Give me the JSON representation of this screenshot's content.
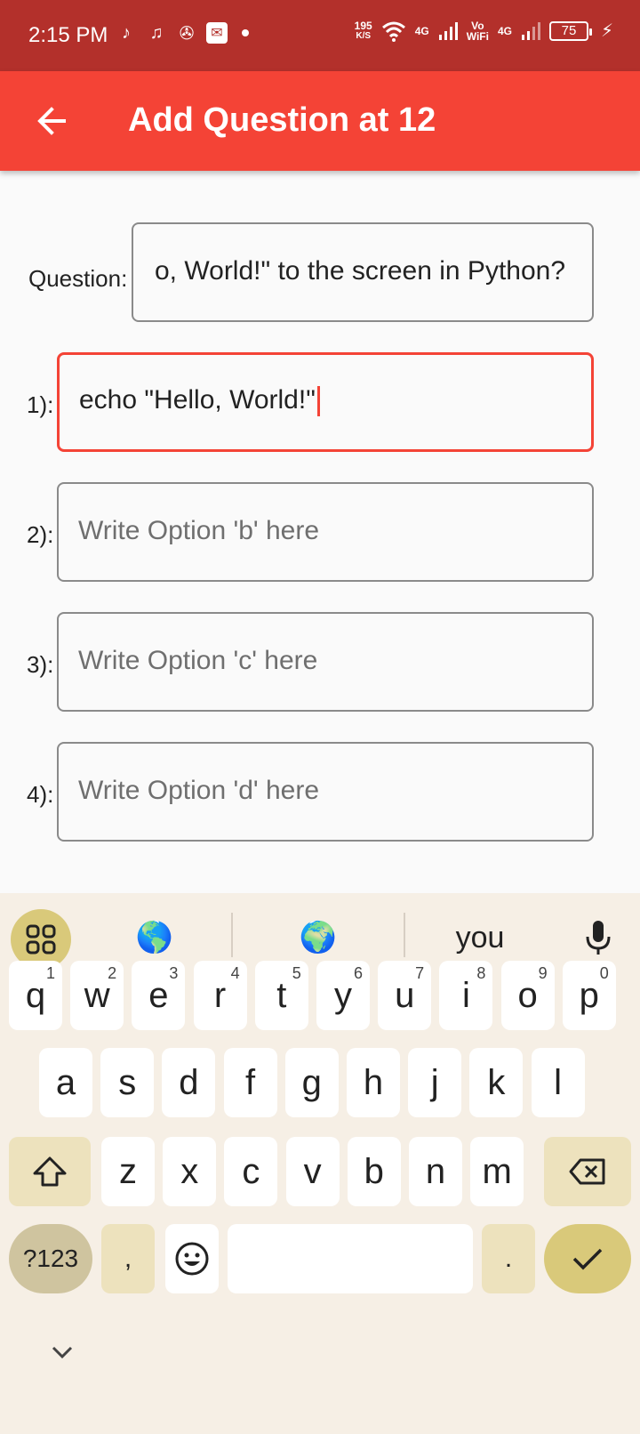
{
  "status_bar": {
    "time": "2:15 PM",
    "left_icons": [
      "tiktok-icon",
      "music-icon",
      "pinwheel-icon",
      "mail-icon"
    ],
    "net_speed_value": "195",
    "net_speed_unit": "K/S",
    "net1": "4G",
    "volte_top": "Vo",
    "volte_bottom": "WiFi",
    "net2": "4G",
    "battery": "75"
  },
  "app_bar": {
    "title": "Add Question at 12"
  },
  "form": {
    "question_label": "Question:",
    "question_value": "o, World!\" to the screen in Python?",
    "options": [
      {
        "label": "1):",
        "value": "echo \"Hello, World!\"",
        "placeholder": ""
      },
      {
        "label": "2):",
        "value": "",
        "placeholder": "Write Option 'b' here"
      },
      {
        "label": "3):",
        "value": "",
        "placeholder": "Write Option 'c' here"
      },
      {
        "label": "4):",
        "value": "",
        "placeholder": "Write Option 'd' here"
      }
    ]
  },
  "keyboard": {
    "suggestions": [
      "🌎",
      "🌍",
      "you"
    ],
    "row1": [
      {
        "k": "q",
        "h": "1"
      },
      {
        "k": "w",
        "h": "2"
      },
      {
        "k": "e",
        "h": "3"
      },
      {
        "k": "r",
        "h": "4"
      },
      {
        "k": "t",
        "h": "5"
      },
      {
        "k": "y",
        "h": "6"
      },
      {
        "k": "u",
        "h": "7"
      },
      {
        "k": "i",
        "h": "8"
      },
      {
        "k": "o",
        "h": "9"
      },
      {
        "k": "p",
        "h": "0"
      }
    ],
    "row2": [
      "a",
      "s",
      "d",
      "f",
      "g",
      "h",
      "j",
      "k",
      "l"
    ],
    "row3": [
      "z",
      "x",
      "c",
      "v",
      "b",
      "n",
      "m"
    ],
    "symbols_label": "?123",
    "comma_label": ",",
    "period_label": "."
  }
}
